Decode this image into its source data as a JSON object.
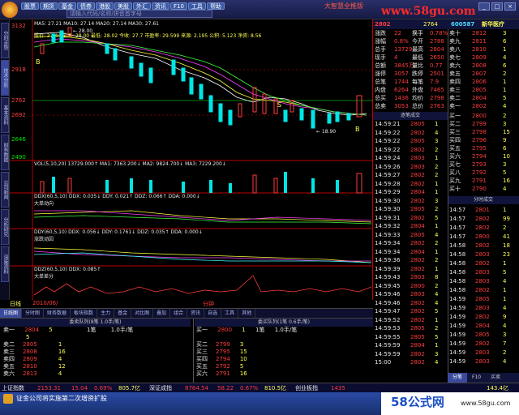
{
  "app": {
    "menu": [
      "股票",
      "期货",
      "基金",
      "债券",
      "港股",
      "美股",
      "外汇",
      "资讯",
      "F10",
      "工具",
      "帮助"
    ],
    "search_placeholder": "请输入代码/名称/拼音首字母",
    "brand_text": "大智慧全推版",
    "window_buttons": [
      "_",
      "□",
      "×"
    ]
  },
  "watermark": {
    "site_top": "www.58gu.com",
    "site_bottom_cn": "58公式网",
    "site_bottom_url": "www.58gu.com"
  },
  "left_tabs": [
    "分时走势",
    "技术分析",
    "基本资料",
    "财务数据",
    "公司新闻",
    "分析研究",
    "深度资料"
  ],
  "kline": {
    "legend": "MA5: 27.21  MA10: 27.14  MA20: 27.14  MA30: 27.61",
    "info": "股价: 27.44  最高: 28.00  最低: 28.02  今收: 27.7  市盈率: 29.599  来源: 2.195  公积: 5.123  净资: 8.56",
    "price_labels": [
      "3132",
      "2918",
      "2762",
      "2692",
      "2646",
      "2490"
    ],
    "note": "← 28.00",
    "low_note": "← 18.90",
    "marker_b": "B",
    "marker_s": "S"
  },
  "volume": {
    "legend": "VOL(5,10,20)  13729.000↑  MA1: 7363.200↓  MA2: 9824.700↓  MA3: 7229.200↓"
  },
  "ddx": {
    "legend": "DDX(60,5,10)  DDX: 0.035↓  DDY: 0.021↑  DDZ: 0.066↑  DDA: 0.000↓",
    "label": "大单动向"
  },
  "ddy": {
    "legend": "DDY(60,5,10)  DDX: 0.056↓  DDY: 0.1761↓  DDZ: 0.035↑  DDA: 0.000↓",
    "label": "涨跌动因"
  },
  "ddz": {
    "legend": "DDZ(60,5,10)  DDX: 0.085↑",
    "label": "大单差分"
  },
  "flash": {
    "left": "日线",
    "mid": "2010/06/",
    "right": "分钟"
  },
  "bottom_tabs": [
    "日线图",
    "分时图",
    "财务数据",
    "板块指数",
    "主力",
    "基金",
    "对比图",
    "叠加",
    "组合",
    "资讯",
    "自选",
    "工具",
    "其他"
  ],
  "orderbook": {
    "head_left": "委卖队列(8笔 1.0手/笔)",
    "head_right": "委买队列(1笔 0.6手/笔)",
    "sell_label": "卖一",
    "sell_price": "2804",
    "sell_count": "5",
    "sell_unit": "1笔",
    "sell_hand": "5",
    "sell_note": "1.0手/笔",
    "buy_label": "买一",
    "buy_price": "2800",
    "buy_count": "1",
    "buy_unit": "1笔",
    "buy_note": "1.0手/笔",
    "sell_rows": [
      [
        "卖二",
        "2805",
        "1"
      ],
      [
        "卖三",
        "2808",
        "16"
      ],
      [
        "卖四",
        "2809",
        "4"
      ],
      [
        "卖五",
        "2810",
        "12"
      ],
      [
        "卖六",
        "2813",
        "4"
      ]
    ],
    "buy_rows": [
      [
        "买二",
        "2799",
        "3"
      ],
      [
        "买三",
        "2795",
        "15"
      ],
      [
        "买四",
        "2794",
        "10"
      ],
      [
        "买五",
        "2792",
        "5"
      ],
      [
        "买六",
        "2791",
        "16"
      ]
    ]
  },
  "quote": {
    "code": "600587",
    "name": "新华医疗",
    "price_label": "2802",
    "price_extra": "2764",
    "rows": [
      [
        "涨跌",
        "22",
        "换手",
        "0.78%"
      ],
      [
        "涨幅",
        "0.8%",
        "今开",
        "2788"
      ],
      [
        "总手",
        "13729",
        "最高",
        "2804"
      ],
      [
        "现手",
        "4",
        "最低",
        "2650"
      ],
      [
        "总额",
        "3845万",
        "量比",
        "0.77"
      ],
      [
        "涨停",
        "3057",
        "跌停",
        "2501"
      ],
      [
        "总笔",
        "1744",
        "每笔",
        "7.9"
      ],
      [
        "内盘",
        "6264",
        "外盘",
        "7465"
      ],
      [
        "总买",
        "1436",
        "均价",
        "2798"
      ],
      [
        "总卖",
        "3053",
        "总价",
        "2763"
      ]
    ],
    "ask_rows": [
      [
        "卖十",
        "2812",
        "3"
      ],
      [
        "卖九",
        "2811",
        "6"
      ],
      [
        "卖八",
        "2810",
        "1"
      ],
      [
        "卖七",
        "2809",
        "4"
      ],
      [
        "卖六",
        "2808",
        "6"
      ],
      [
        "卖五",
        "2807",
        "2"
      ],
      [
        "卖四",
        "2806",
        "1"
      ],
      [
        "卖三",
        "2805",
        "1"
      ],
      [
        "卖二",
        "2804",
        "5"
      ],
      [
        "卖一",
        "2802",
        "4"
      ]
    ],
    "bid_rows": [
      [
        "买一",
        "2800",
        "2"
      ],
      [
        "买二",
        "2799",
        "3"
      ],
      [
        "买三",
        "2798",
        "15"
      ],
      [
        "买四",
        "2796",
        "9"
      ],
      [
        "买五",
        "2795",
        "6"
      ],
      [
        "买六",
        "2794",
        "10"
      ],
      [
        "买七",
        "2793",
        "3"
      ],
      [
        "买八",
        "2792",
        "5"
      ],
      [
        "买九",
        "2791",
        "16"
      ],
      [
        "买十",
        "2790",
        "4"
      ]
    ],
    "ticks_header": "逐笔成交",
    "ticks": [
      [
        "14:59:21",
        "2805",
        "1"
      ],
      [
        "14:59:22",
        "2802",
        "4"
      ],
      [
        "14:59:22",
        "2805",
        "3"
      ],
      [
        "14:59:22",
        "2802",
        "2"
      ],
      [
        "14:59:24",
        "2803",
        "1"
      ],
      [
        "14:59:26",
        "2803",
        "2"
      ],
      [
        "14:59:27",
        "2802",
        "2"
      ],
      [
        "14:59:28",
        "2802",
        "1"
      ],
      [
        "14:59:29",
        "2804",
        "1"
      ],
      [
        "14:59:30",
        "2802",
        "3"
      ],
      [
        "14:59:30",
        "2805",
        "2"
      ],
      [
        "14:59:31",
        "2802",
        "5"
      ],
      [
        "14:59:32",
        "2804",
        "1"
      ],
      [
        "14:59:33",
        "2805",
        "4"
      ],
      [
        "14:59:34",
        "2802",
        "2"
      ],
      [
        "14:59:34",
        "2804",
        "1"
      ],
      [
        "14:59:36",
        "2802",
        "2"
      ],
      [
        "14:59:39",
        "2802",
        "1"
      ],
      [
        "14:59:43",
        "2803",
        "8"
      ],
      [
        "14:59:45",
        "2800",
        "2"
      ],
      [
        "14:59:46",
        "2803",
        "4"
      ],
      [
        "14:59:46",
        "2802",
        "4"
      ],
      [
        "14:59:47",
        "2802",
        "5"
      ],
      [
        "14:59:52",
        "2802",
        "1"
      ],
      [
        "14:59:53",
        "2805",
        "2"
      ],
      [
        "14:59:55",
        "2805",
        "5"
      ],
      [
        "14:59:59",
        "2804",
        "1"
      ],
      [
        "14:59:59",
        "2802",
        "3"
      ],
      [
        "15:00",
        "2802",
        "4"
      ]
    ],
    "minute_header": "分时成交",
    "minute": [
      [
        "14:57",
        "2801",
        "1"
      ],
      [
        "14:57",
        "2802",
        "99"
      ],
      [
        "14:57",
        "2802",
        "2"
      ],
      [
        "14:57",
        "2800",
        "41"
      ],
      [
        "14:58",
        "2802",
        "18"
      ],
      [
        "14:58",
        "2803",
        "23"
      ],
      [
        "14:58",
        "2802",
        "1"
      ],
      [
        "14:58",
        "2803",
        "5"
      ],
      [
        "14:58",
        "2803",
        "4"
      ],
      [
        "14:58",
        "2802",
        "1"
      ],
      [
        "14:59",
        "2805",
        "1"
      ],
      [
        "14:59",
        "2803",
        "4"
      ],
      [
        "14:59",
        "2802",
        "9"
      ],
      [
        "14:59",
        "2804",
        "4"
      ],
      [
        "14:59",
        "2805",
        "3"
      ],
      [
        "14:59",
        "2802",
        "7"
      ],
      [
        "14:59",
        "2803",
        "2"
      ],
      [
        "14:59",
        "2803",
        "4"
      ]
    ],
    "bottom_tabs": [
      "分笔",
      "F10",
      "买卖"
    ]
  },
  "ticker": {
    "sh_label": "上证指数",
    "sh_val": "2153.31",
    "sh_chg": "15.04",
    "sh_pct": "0.69%",
    "sh_amt": "805.7亿",
    "sz_label": "深证成指",
    "sz_val": "8764.54",
    "sz_chg": "58.22",
    "sz_pct": "0.67%",
    "sz_amt": "810.5亿",
    "cy_label": "创业板指",
    "cy_val": "1435",
    "cy_pct": "143.4亿"
  },
  "taskbar": {
    "news": "证金公司将实施第二次增资扩股"
  }
}
